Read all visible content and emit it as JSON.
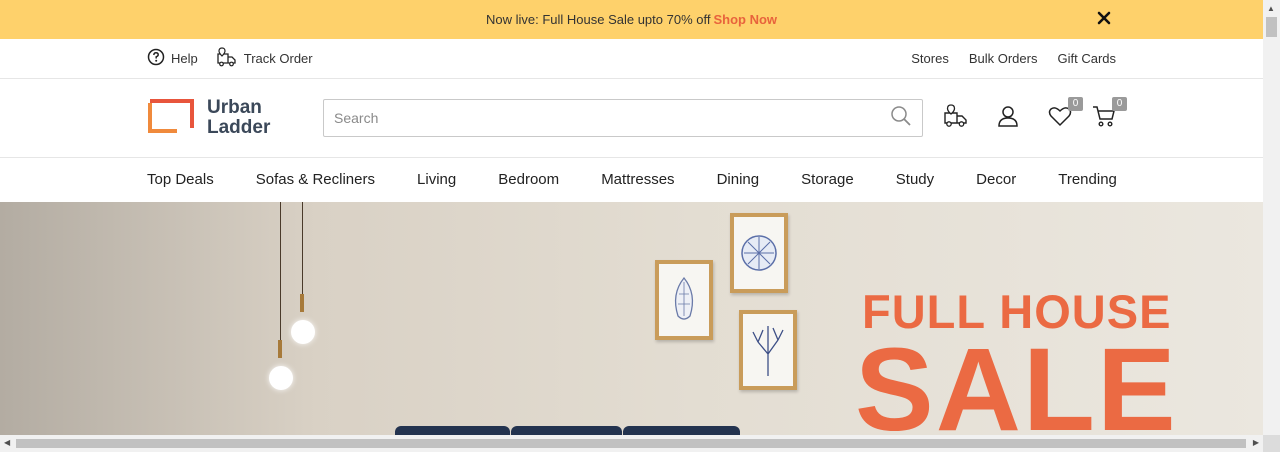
{
  "announcement": {
    "text": "Now live: Full House Sale upto 70% off",
    "link": "Shop Now"
  },
  "utility": {
    "help": "Help",
    "track_order": "Track Order",
    "stores": "Stores",
    "bulk_orders": "Bulk Orders",
    "gift_cards": "Gift Cards"
  },
  "logo": {
    "line1": "Urban",
    "line2": "Ladder"
  },
  "search": {
    "placeholder": "Search"
  },
  "header_icons": {
    "wishlist_count": "0",
    "cart_count": "0"
  },
  "nav": {
    "items": [
      "Top Deals",
      "Sofas & Recliners",
      "Living",
      "Bedroom",
      "Mattresses",
      "Dining",
      "Storage",
      "Study",
      "Decor",
      "Trending"
    ]
  },
  "hero": {
    "headline_line1": "FULL HOUSE",
    "headline_line2": "SALE"
  },
  "colors": {
    "announcement_bg": "#fed16b",
    "accent": "#e8633c",
    "logo_text": "#3b4859"
  }
}
